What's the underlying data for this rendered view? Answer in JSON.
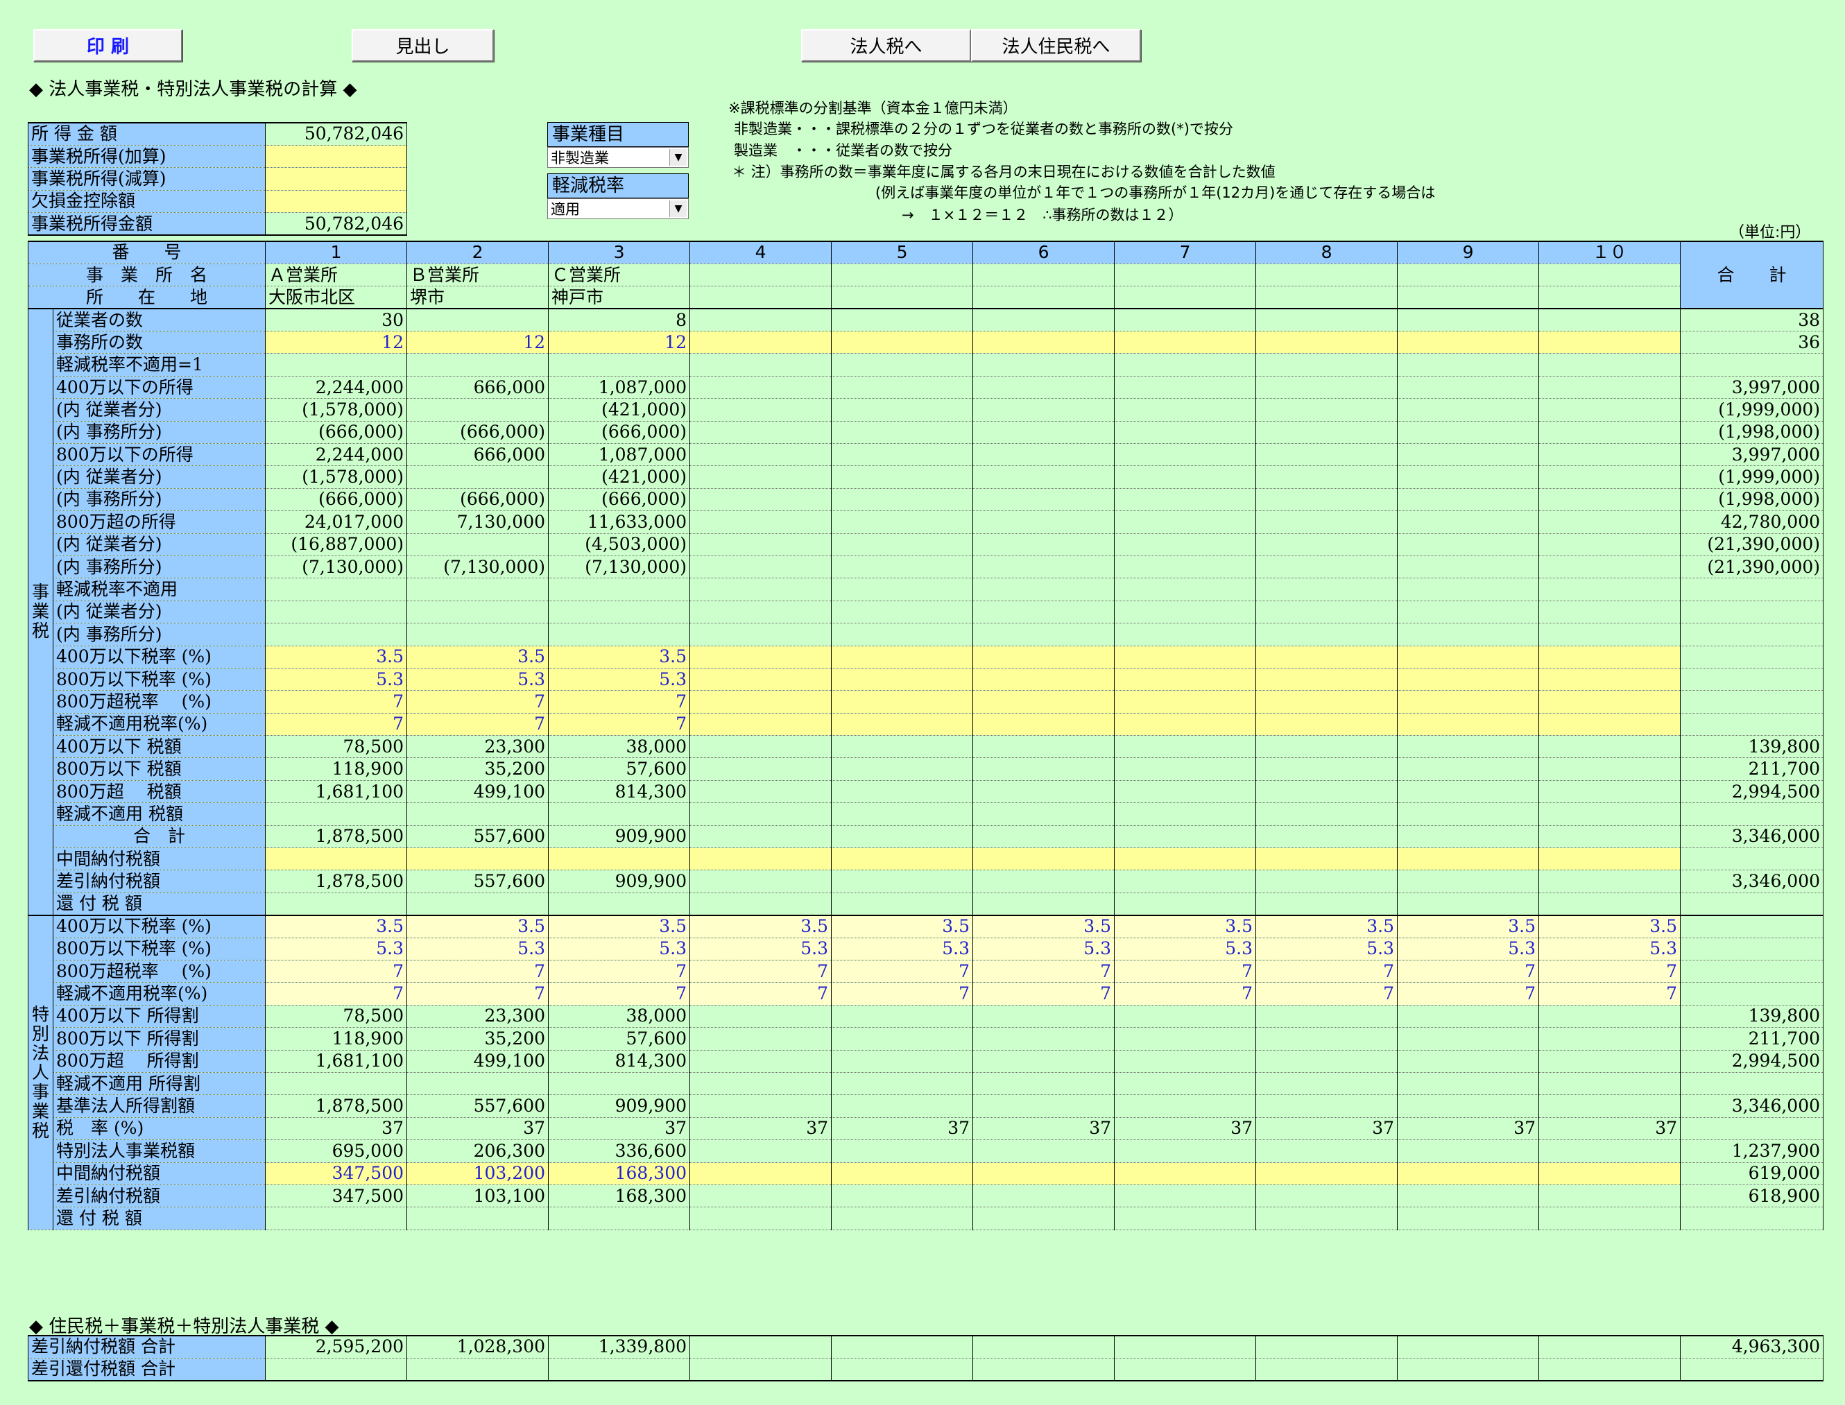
{
  "toolbar": {
    "print": "印 刷",
    "heading": "見出し",
    "to_corp_tax": "法人税へ",
    "to_resident_tax": "法人住民税へ"
  },
  "page_title": "◆ 法人事業税・特別法人事業税の計算 ◆",
  "income": {
    "rows": [
      {
        "label": "所 得 金 額",
        "value": "50,782,046"
      },
      {
        "label": "事業税所得(加算)",
        "value": ""
      },
      {
        "label": "事業税所得(減算)",
        "value": ""
      },
      {
        "label": "欠損金控除額",
        "value": ""
      },
      {
        "label": "事業税所得金額",
        "value": "50,782,046"
      }
    ]
  },
  "business_type": {
    "label": "事業種目",
    "value": "非製造業"
  },
  "reduced_rate": {
    "label": "軽減税率",
    "value": "適用"
  },
  "notes": [
    "※課税標準の分割基準（資本金１億円未満）",
    "非製造業・・・課税標準の２分の１ずつを従業者の数と事務所の数(*)で按分",
    "製造業　・・・従業者の数で按分",
    "＊ 注）事務所の数＝事業年度に属する各月の末日現在における数値を合計した数値",
    "(例えば事業年度の単位が１年で１つの事務所が１年(12カ月)を通じて存在する場合は",
    "→　１×１２＝１２　∴事務所の数は１２）"
  ],
  "unit": "（単位:円）",
  "header": {
    "number_label": "番　　号",
    "numbers": [
      "1",
      "2",
      "3",
      "4",
      "5",
      "6",
      "7",
      "8",
      "9",
      "１０"
    ],
    "office_label": "事　業　所　名",
    "offices": [
      "Ａ営業所",
      "Ｂ営業所",
      "Ｃ営業所",
      "",
      "",
      "",
      "",
      "",
      "",
      ""
    ],
    "location_label": "所　　在　　地",
    "locations": [
      "大阪市北区",
      "堺市",
      "神戸市",
      "",
      "",
      "",
      "",
      "",
      "",
      ""
    ],
    "total_label": "合　　計"
  },
  "side_labels": {
    "business_tax": "事業税",
    "special_tax": "特別法人事業税"
  },
  "business_rows": [
    {
      "label": "従業者の数",
      "values": [
        "30",
        "",
        "8",
        "",
        "",
        "",
        "",
        "",
        "",
        ""
      ],
      "total": "38"
    },
    {
      "label": "事務所の数",
      "values": [
        "12",
        "12",
        "12",
        "",
        "",
        "",
        "",
        "",
        "",
        ""
      ],
      "total": "36"
    },
    {
      "label": "軽減税率不適用=1",
      "values": [
        "",
        "",
        "",
        "",
        "",
        "",
        "",
        "",
        "",
        ""
      ],
      "total": ""
    },
    {
      "label": "400万以下の所得",
      "values": [
        "2,244,000",
        "666,000",
        "1,087,000",
        "",
        "",
        "",
        "",
        "",
        "",
        ""
      ],
      "total": "3,997,000"
    },
    {
      "label": "(内 従業者分)",
      "values": [
        "(1,578,000)",
        "",
        "(421,000)",
        "",
        "",
        "",
        "",
        "",
        "",
        ""
      ],
      "total": "(1,999,000)"
    },
    {
      "label": "(内 事務所分)",
      "values": [
        "(666,000)",
        "(666,000)",
        "(666,000)",
        "",
        "",
        "",
        "",
        "",
        "",
        ""
      ],
      "total": "(1,998,000)"
    },
    {
      "label": "800万以下の所得",
      "values": [
        "2,244,000",
        "666,000",
        "1,087,000",
        "",
        "",
        "",
        "",
        "",
        "",
        ""
      ],
      "total": "3,997,000"
    },
    {
      "label": "(内 従業者分)",
      "values": [
        "(1,578,000)",
        "",
        "(421,000)",
        "",
        "",
        "",
        "",
        "",
        "",
        ""
      ],
      "total": "(1,999,000)"
    },
    {
      "label": "(内 事務所分)",
      "values": [
        "(666,000)",
        "(666,000)",
        "(666,000)",
        "",
        "",
        "",
        "",
        "",
        "",
        ""
      ],
      "total": "(1,998,000)"
    },
    {
      "label": "800万超の所得",
      "values": [
        "24,017,000",
        "7,130,000",
        "11,633,000",
        "",
        "",
        "",
        "",
        "",
        "",
        ""
      ],
      "total": "42,780,000"
    },
    {
      "label": "(内 従業者分)",
      "values": [
        "(16,887,000)",
        "",
        "(4,503,000)",
        "",
        "",
        "",
        "",
        "",
        "",
        ""
      ],
      "total": "(21,390,000)"
    },
    {
      "label": "(内 事務所分)",
      "values": [
        "(7,130,000)",
        "(7,130,000)",
        "(7,130,000)",
        "",
        "",
        "",
        "",
        "",
        "",
        ""
      ],
      "total": "(21,390,000)"
    },
    {
      "label": "軽減税率不適用",
      "values": [
        "",
        "",
        "",
        "",
        "",
        "",
        "",
        "",
        "",
        ""
      ],
      "total": ""
    },
    {
      "label": "(内 従業者分)",
      "values": [
        "",
        "",
        "",
        "",
        "",
        "",
        "",
        "",
        "",
        ""
      ],
      "total": ""
    },
    {
      "label": "(内 事務所分)",
      "values": [
        "",
        "",
        "",
        "",
        "",
        "",
        "",
        "",
        "",
        ""
      ],
      "total": ""
    },
    {
      "label": "400万以下税率 (%)",
      "values": [
        "3.5",
        "3.5",
        "3.5",
        "",
        "",
        "",
        "",
        "",
        "",
        ""
      ],
      "total": ""
    },
    {
      "label": "800万以下税率 (%)",
      "values": [
        "5.3",
        "5.3",
        "5.3",
        "",
        "",
        "",
        "",
        "",
        "",
        ""
      ],
      "total": ""
    },
    {
      "label": "800万超税率　 (%)",
      "values": [
        "7",
        "7",
        "7",
        "",
        "",
        "",
        "",
        "",
        "",
        ""
      ],
      "total": ""
    },
    {
      "label": "軽減不適用税率(%)",
      "values": [
        "7",
        "7",
        "7",
        "",
        "",
        "",
        "",
        "",
        "",
        ""
      ],
      "total": ""
    },
    {
      "label": "400万以下 税額",
      "values": [
        "78,500",
        "23,300",
        "38,000",
        "",
        "",
        "",
        "",
        "",
        "",
        ""
      ],
      "total": "139,800"
    },
    {
      "label": "800万以下 税額",
      "values": [
        "118,900",
        "35,200",
        "57,600",
        "",
        "",
        "",
        "",
        "",
        "",
        ""
      ],
      "total": "211,700"
    },
    {
      "label": "800万超　 税額",
      "values": [
        "1,681,100",
        "499,100",
        "814,300",
        "",
        "",
        "",
        "",
        "",
        "",
        ""
      ],
      "total": "2,994,500"
    },
    {
      "label": "軽減不適用 税額",
      "values": [
        "",
        "",
        "",
        "",
        "",
        "",
        "",
        "",
        "",
        ""
      ],
      "total": ""
    },
    {
      "label": "合　計",
      "values": [
        "1,878,500",
        "557,600",
        "909,900",
        "",
        "",
        "",
        "",
        "",
        "",
        ""
      ],
      "total": "3,346,000"
    },
    {
      "label": "中間納付税額",
      "values": [
        "",
        "",
        "",
        "",
        "",
        "",
        "",
        "",
        "",
        ""
      ],
      "total": ""
    },
    {
      "label": "差引納付税額",
      "values": [
        "1,878,500",
        "557,600",
        "909,900",
        "",
        "",
        "",
        "",
        "",
        "",
        ""
      ],
      "total": "3,346,000"
    },
    {
      "label": "還 付 税 額",
      "values": [
        "",
        "",
        "",
        "",
        "",
        "",
        "",
        "",
        "",
        ""
      ],
      "total": ""
    }
  ],
  "special_rows": [
    {
      "label": "400万以下税率 (%)",
      "values": [
        "3.5",
        "3.5",
        "3.5",
        "3.5",
        "3.5",
        "3.5",
        "3.5",
        "3.5",
        "3.5",
        "3.5"
      ],
      "total": ""
    },
    {
      "label": "800万以下税率 (%)",
      "values": [
        "5.3",
        "5.3",
        "5.3",
        "5.3",
        "5.3",
        "5.3",
        "5.3",
        "5.3",
        "5.3",
        "5.3"
      ],
      "total": ""
    },
    {
      "label": "800万超税率　 (%)",
      "values": [
        "7",
        "7",
        "7",
        "7",
        "7",
        "7",
        "7",
        "7",
        "7",
        "7"
      ],
      "total": ""
    },
    {
      "label": "軽減不適用税率(%)",
      "values": [
        "7",
        "7",
        "7",
        "7",
        "7",
        "7",
        "7",
        "7",
        "7",
        "7"
      ],
      "total": ""
    },
    {
      "label": "400万以下 所得割",
      "values": [
        "78,500",
        "23,300",
        "38,000",
        "",
        "",
        "",
        "",
        "",
        "",
        ""
      ],
      "total": "139,800"
    },
    {
      "label": "800万以下 所得割",
      "values": [
        "118,900",
        "35,200",
        "57,600",
        "",
        "",
        "",
        "",
        "",
        "",
        ""
      ],
      "total": "211,700"
    },
    {
      "label": "800万超　 所得割",
      "values": [
        "1,681,100",
        "499,100",
        "814,300",
        "",
        "",
        "",
        "",
        "",
        "",
        ""
      ],
      "total": "2,994,500"
    },
    {
      "label": "軽減不適用 所得割",
      "values": [
        "",
        "",
        "",
        "",
        "",
        "",
        "",
        "",
        "",
        ""
      ],
      "total": ""
    },
    {
      "label": "基準法人所得割額",
      "values": [
        "1,878,500",
        "557,600",
        "909,900",
        "",
        "",
        "",
        "",
        "",
        "",
        ""
      ],
      "total": "3,346,000"
    },
    {
      "label": "税　率 (%)",
      "values": [
        "37",
        "37",
        "37",
        "37",
        "37",
        "37",
        "37",
        "37",
        "37",
        "37"
      ],
      "total": ""
    },
    {
      "label": "特別法人事業税額",
      "values": [
        "695,000",
        "206,300",
        "336,600",
        "",
        "",
        "",
        "",
        "",
        "",
        ""
      ],
      "total": "1,237,900"
    },
    {
      "label": "中間納付税額",
      "values": [
        "347,500",
        "103,200",
        "168,300",
        "",
        "",
        "",
        "",
        "",
        "",
        ""
      ],
      "total": "619,000"
    },
    {
      "label": "差引納付税額",
      "values": [
        "347,500",
        "103,100",
        "168,300",
        "",
        "",
        "",
        "",
        "",
        "",
        ""
      ],
      "total": "618,900"
    },
    {
      "label": "還 付 税 額",
      "values": [
        "",
        "",
        "",
        "",
        "",
        "",
        "",
        "",
        "",
        ""
      ],
      "total": ""
    }
  ],
  "combined": {
    "title": "◆ 住民税＋事業税＋特別法人事業税 ◆",
    "rows": [
      {
        "label": "差引納付税額 合計",
        "values": [
          "2,595,200",
          "1,028,300",
          "1,339,800",
          "",
          "",
          "",
          "",
          "",
          "",
          ""
        ],
        "total": "4,963,300"
      },
      {
        "label": "差引還付税額 合計",
        "values": [
          "",
          "",
          "",
          "",
          "",
          "",
          "",
          "",
          "",
          ""
        ],
        "total": ""
      }
    ]
  }
}
